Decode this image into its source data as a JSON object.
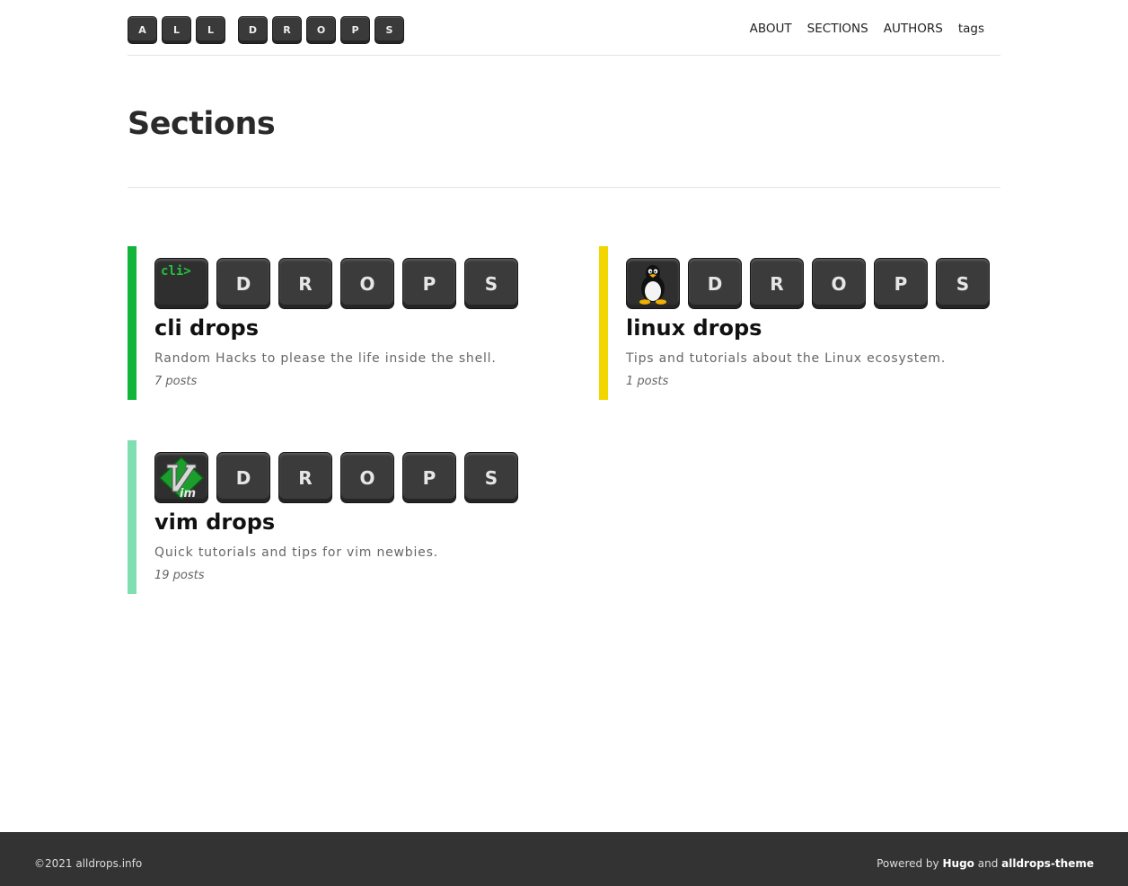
{
  "header": {
    "logo_letters_1": [
      "A",
      "L",
      "L"
    ],
    "logo_letters_2": [
      "D",
      "R",
      "O",
      "P",
      "S"
    ],
    "nav": [
      "ABOUT",
      "SECTIONS",
      "AUTHORS",
      "tags"
    ]
  },
  "page_title": "Sections",
  "sections": [
    {
      "title": "cli drops",
      "description": "Random Hacks to please the life inside the shell.",
      "count": "7 posts",
      "icon_label": "cli>",
      "icon": "cli-icon",
      "accent": "#11b53a",
      "keys": [
        "D",
        "R",
        "O",
        "P",
        "S"
      ]
    },
    {
      "title": "linux drops",
      "description": "Tips and tutorials about the Linux ecosystem.",
      "count": "1 posts",
      "icon": "tux-penguin-icon",
      "accent": "#f2d600",
      "keys": [
        "D",
        "R",
        "O",
        "P",
        "S"
      ]
    },
    {
      "title": "vim drops",
      "description": "Quick tutorials and tips for vim newbies.",
      "count": "19 posts",
      "icon": "vim-logo-icon",
      "accent": "#7fdfb0",
      "keys": [
        "D",
        "R",
        "O",
        "P",
        "S"
      ]
    }
  ],
  "footer": {
    "copyright": "©2021 alldrops.info",
    "powered_prefix": "Powered by",
    "hugo": "Hugo",
    "and": "and",
    "theme": "alldrops-theme"
  }
}
